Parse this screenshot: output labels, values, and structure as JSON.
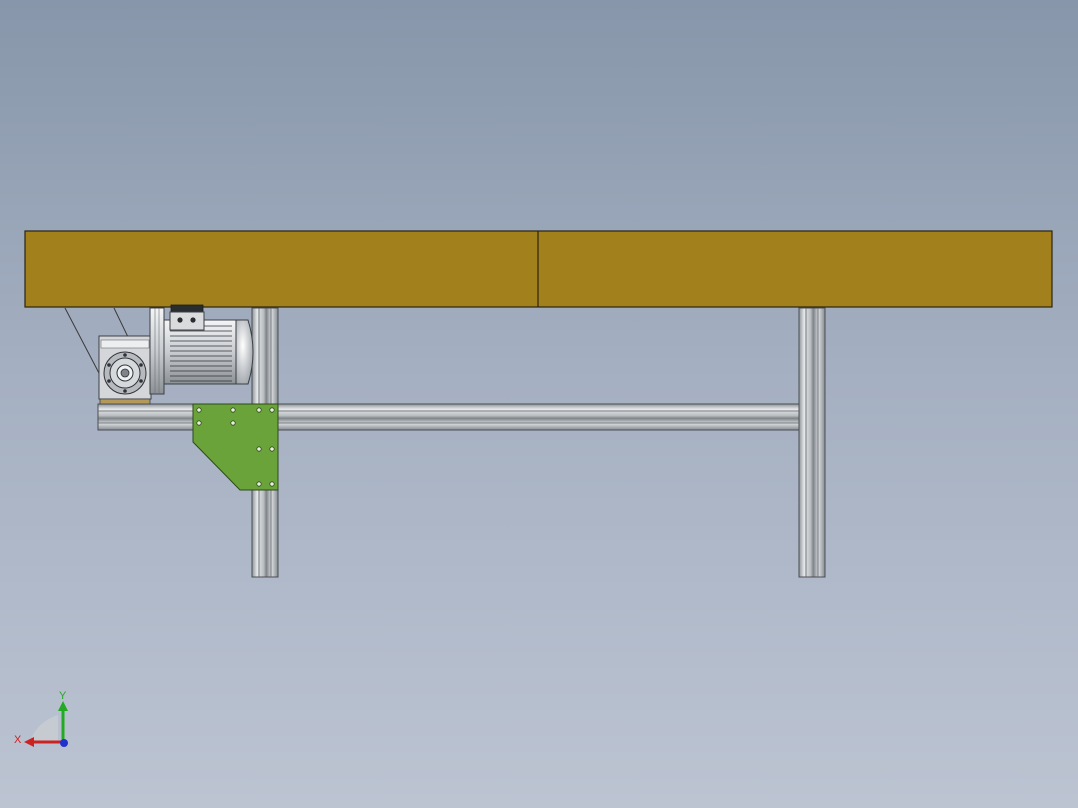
{
  "viewport": {
    "background_top": "#8796aa",
    "background_bottom": "#bcc4d2"
  },
  "model": {
    "belt_color": "#a2811c",
    "plate_color": "#6aa33a",
    "frame_color": "#c4c8cc",
    "motor_color": "#d8dadc"
  },
  "triad": {
    "x_label": "X",
    "y_label": "Y",
    "x_color": "#cc2222",
    "y_color": "#22aa22",
    "z_color": "#2233cc"
  }
}
